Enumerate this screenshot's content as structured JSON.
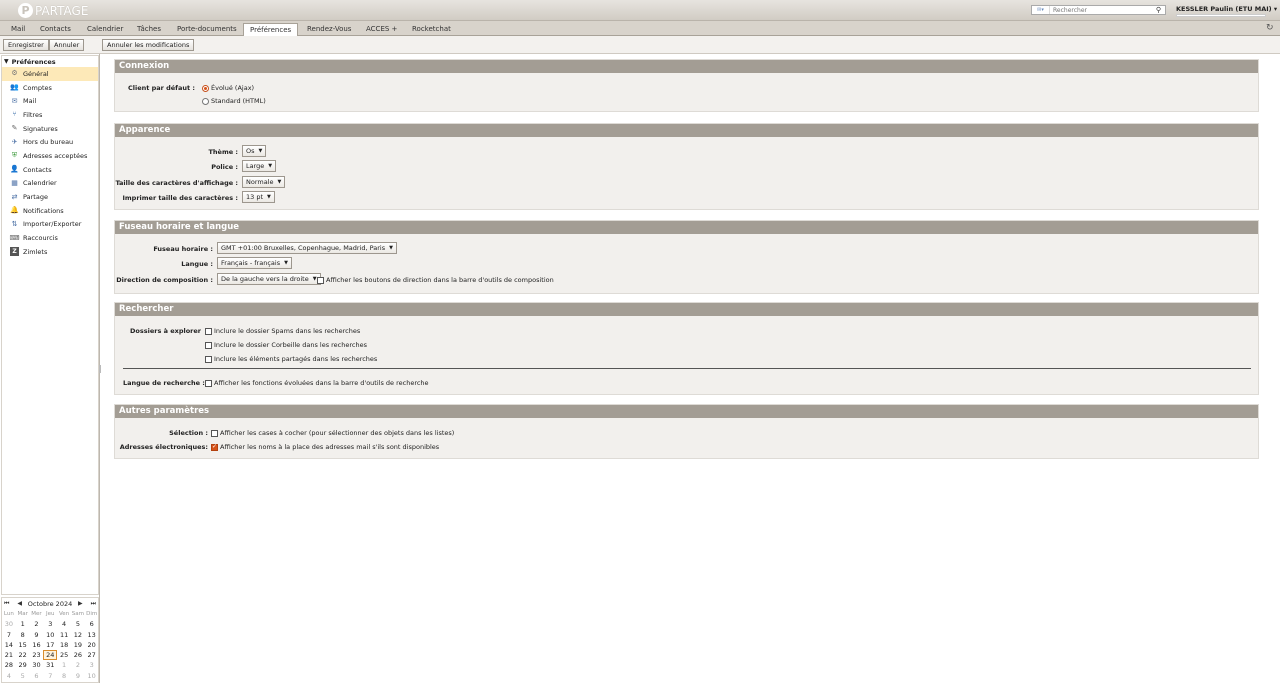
{
  "app": {
    "logo_text": "PARTAGE",
    "logo_letter": "P",
    "user": "KESSLER Paulin (ETU MAI)"
  },
  "search": {
    "placeholder": "Rechercher"
  },
  "tabs": [
    "Mail",
    "Contacts",
    "Calendrier",
    "Tâches",
    "Porte-documents",
    "Préférences",
    "Rendez-Vous",
    "ACCES +",
    "Rocketchat"
  ],
  "active_tab": "Préférences",
  "toolbar": {
    "save": "Enregistrer",
    "cancel": "Annuler",
    "undo": "Annuler les modifications"
  },
  "sidebar": {
    "header": "Préférences",
    "items": [
      {
        "label": "Général",
        "icon": "gear-icon"
      },
      {
        "label": "Comptes",
        "icon": "accounts-icon"
      },
      {
        "label": "Mail",
        "icon": "mail-icon"
      },
      {
        "label": "Filtres",
        "icon": "filter-icon"
      },
      {
        "label": "Signatures",
        "icon": "signature-icon"
      },
      {
        "label": "Hors du bureau",
        "icon": "out-of-office-icon"
      },
      {
        "label": "Adresses acceptées",
        "icon": "shield-check-icon"
      },
      {
        "label": "Contacts",
        "icon": "contacts-icon"
      },
      {
        "label": "Calendrier",
        "icon": "calendar-icon"
      },
      {
        "label": "Partage",
        "icon": "share-icon"
      },
      {
        "label": "Notifications",
        "icon": "bell-icon"
      },
      {
        "label": "Importer/Exporter",
        "icon": "import-export-icon"
      },
      {
        "label": "Raccourcis",
        "icon": "shortcuts-icon"
      },
      {
        "label": "Zimlets",
        "icon": "zimlets-icon"
      }
    ]
  },
  "calendar": {
    "month": "Octobre 2024",
    "weekdays": [
      "Lun",
      "Mar",
      "Mer",
      "Jeu",
      "Ven",
      "Sam",
      "Dim"
    ],
    "weeks": [
      [
        "30",
        "1",
        "2",
        "3",
        "4",
        "5",
        "6"
      ],
      [
        "7",
        "8",
        "9",
        "10",
        "11",
        "12",
        "13"
      ],
      [
        "14",
        "15",
        "16",
        "17",
        "18",
        "19",
        "20"
      ],
      [
        "21",
        "22",
        "23",
        "24",
        "25",
        "26",
        "27"
      ],
      [
        "28",
        "29",
        "30",
        "31",
        "1",
        "2",
        "3"
      ],
      [
        "4",
        "5",
        "6",
        "7",
        "8",
        "9",
        "10"
      ]
    ],
    "today": "24"
  },
  "sections": {
    "connexion": {
      "title": "Connexion",
      "client_label": "Client par défaut :",
      "opt_advanced": "Évolué (Ajax)",
      "opt_standard": "Standard (HTML)",
      "selected": "advanced"
    },
    "apparence": {
      "title": "Apparence",
      "theme_label": "Thème :",
      "theme_value": "Os",
      "font_label": "Police :",
      "font_value": "Large",
      "size_label": "Taille des caractères d'affichage :",
      "size_value": "Normale",
      "print_label": "Imprimer taille des caractères :",
      "print_value": "13 pt"
    },
    "fuseau": {
      "title": "Fuseau horaire et langue",
      "tz_label": "Fuseau horaire :",
      "tz_value": "GMT +01:00 Bruxelles, Copenhague, Madrid, Paris",
      "lang_label": "Langue :",
      "lang_value": "Français - français",
      "dir_label": "Direction de composition :",
      "dir_value": "De la gauche vers la droite",
      "dir_buttons": "Afficher les boutons de direction dans la barre d'outils de composition",
      "dir_buttons_checked": false
    },
    "rechercher": {
      "title": "Rechercher",
      "folders_label": "Dossiers à explorer",
      "spam": "Inclure le dossier Spams dans les recherches",
      "trash": "Inclure le dossier Corbeille dans les recherches",
      "shared": "Inclure les éléments partagés dans les recherches",
      "lang_label": "Langue de recherche :",
      "advanced": "Afficher les fonctions évoluées dans la barre d'outils de recherche"
    },
    "autres": {
      "title": "Autres paramètres",
      "selection_label": "Sélection :",
      "selection_text": "Afficher les cases à cocher (pour sélectionner des objets dans les listes)",
      "selection_checked": false,
      "emails_label": "Adresses électroniques:",
      "emails_text": "Afficher les noms à la place des adresses mail s'ils sont disponibles",
      "emails_checked": true
    }
  },
  "colors": {
    "accent": "#d6531a",
    "section_header": "#a39d94",
    "selected_row": "#fde9b8"
  }
}
